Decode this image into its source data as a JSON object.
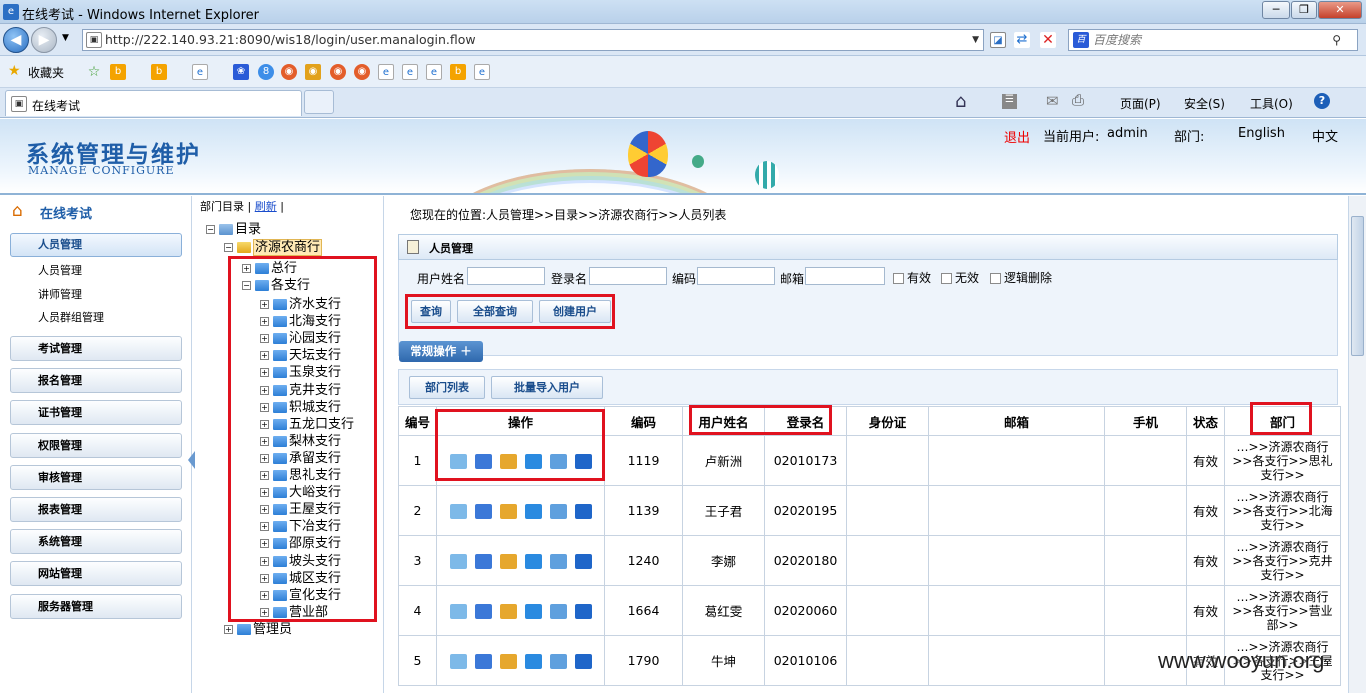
{
  "window": {
    "title": "在线考试 - Windows Internet Explorer"
  },
  "address": {
    "url": "http://222.140.93.21:8090/wis18/login/user.manalogin.flow",
    "search_placeholder": "百度搜索"
  },
  "favbar": {
    "favorites_label": "收藏夹"
  },
  "tab": {
    "label": "在线考试"
  },
  "ietools": {
    "page": "页面(P)",
    "safety": "安全(S)",
    "tools": "工具(O)"
  },
  "header": {
    "title": "系统管理与维护",
    "subtitle": "MANAGE CONFIGURE",
    "logout": "退出",
    "current_user_label": "当前用户:",
    "current_user": "admin",
    "dept_label": "部门:",
    "english": "English",
    "chinese": "中文"
  },
  "leftnav": {
    "title": "在线考试",
    "active": "人员管理",
    "subitems": [
      "人员管理",
      "讲师管理",
      "人员群组管理"
    ],
    "sections": [
      "考试管理",
      "报名管理",
      "证书管理",
      "权限管理",
      "审核管理",
      "报表管理",
      "系统管理",
      "网站管理",
      "服务器管理"
    ]
  },
  "tree": {
    "toolbar": {
      "dir": "部门目录",
      "refresh": "刷新"
    },
    "root": "目录",
    "bank": "济源农商行",
    "head": "总行",
    "branches_label": "各支行",
    "branches": [
      "济水支行",
      "北海支行",
      "沁园支行",
      "天坛支行",
      "玉泉支行",
      "克井支行",
      "轵城支行",
      "五龙口支行",
      "梨林支行",
      "承留支行",
      "思礼支行",
      "大峪支行",
      "王屋支行",
      "下冶支行",
      "邵原支行",
      "坡头支行",
      "城区支行",
      "宣化支行",
      "营业部"
    ],
    "admin": "管理员"
  },
  "main": {
    "breadcrumb": "您现在的位置:人员管理>>目录>>济源农商行>>人员列表",
    "panel_title": "人员管理",
    "filters": {
      "username": "用户姓名",
      "login": "登录名",
      "code": "编码",
      "email": "邮箱",
      "valid": "有效",
      "invalid": "无效",
      "deleted": "逻辑删除"
    },
    "buttons": {
      "query": "查询",
      "query_all": "全部查询",
      "create": "创建用户",
      "dept_list": "部门列表",
      "batch_import": "批量导入用户"
    },
    "ops_toggle": "常规操作 ＋",
    "columns": [
      "编号",
      "操作",
      "编码",
      "用户姓名",
      "登录名",
      "身份证",
      "邮箱",
      "手机",
      "状态",
      "部门"
    ],
    "rows": [
      {
        "no": "1",
        "code": "1119",
        "name": "卢新洲",
        "login": "02010173",
        "id": "",
        "email": "",
        "phone": "",
        "status": "有效",
        "dept1": "…>>济源农商行",
        "dept2": ">>各支行>>思礼",
        "dept3": "支行>>"
      },
      {
        "no": "2",
        "code": "1139",
        "name": "王子君",
        "login": "02020195",
        "id": "",
        "email": "",
        "phone": "",
        "status": "有效",
        "dept1": "…>>济源农商行",
        "dept2": ">>各支行>>北海",
        "dept3": "支行>>"
      },
      {
        "no": "3",
        "code": "1240",
        "name": "李娜",
        "login": "02020180",
        "id": "",
        "email": "",
        "phone": "",
        "status": "有效",
        "dept1": "…>>济源农商行",
        "dept2": ">>各支行>>克井",
        "dept3": "支行>>"
      },
      {
        "no": "4",
        "code": "1664",
        "name": "葛红雯",
        "login": "02020060",
        "id": "",
        "email": "",
        "phone": "",
        "status": "有效",
        "dept1": "…>>济源农商行",
        "dept2": ">>各支行>>营业",
        "dept3": "部>>"
      },
      {
        "no": "5",
        "code": "1790",
        "name": "牛坤",
        "login": "02010106",
        "id": "",
        "email": "",
        "phone": "",
        "status": "有效",
        "dept1": "…>>济源农商行",
        "dept2": ">>各支行>>王屋",
        "dept3": "支行>>"
      }
    ]
  },
  "watermark": "www.wooyun.org"
}
